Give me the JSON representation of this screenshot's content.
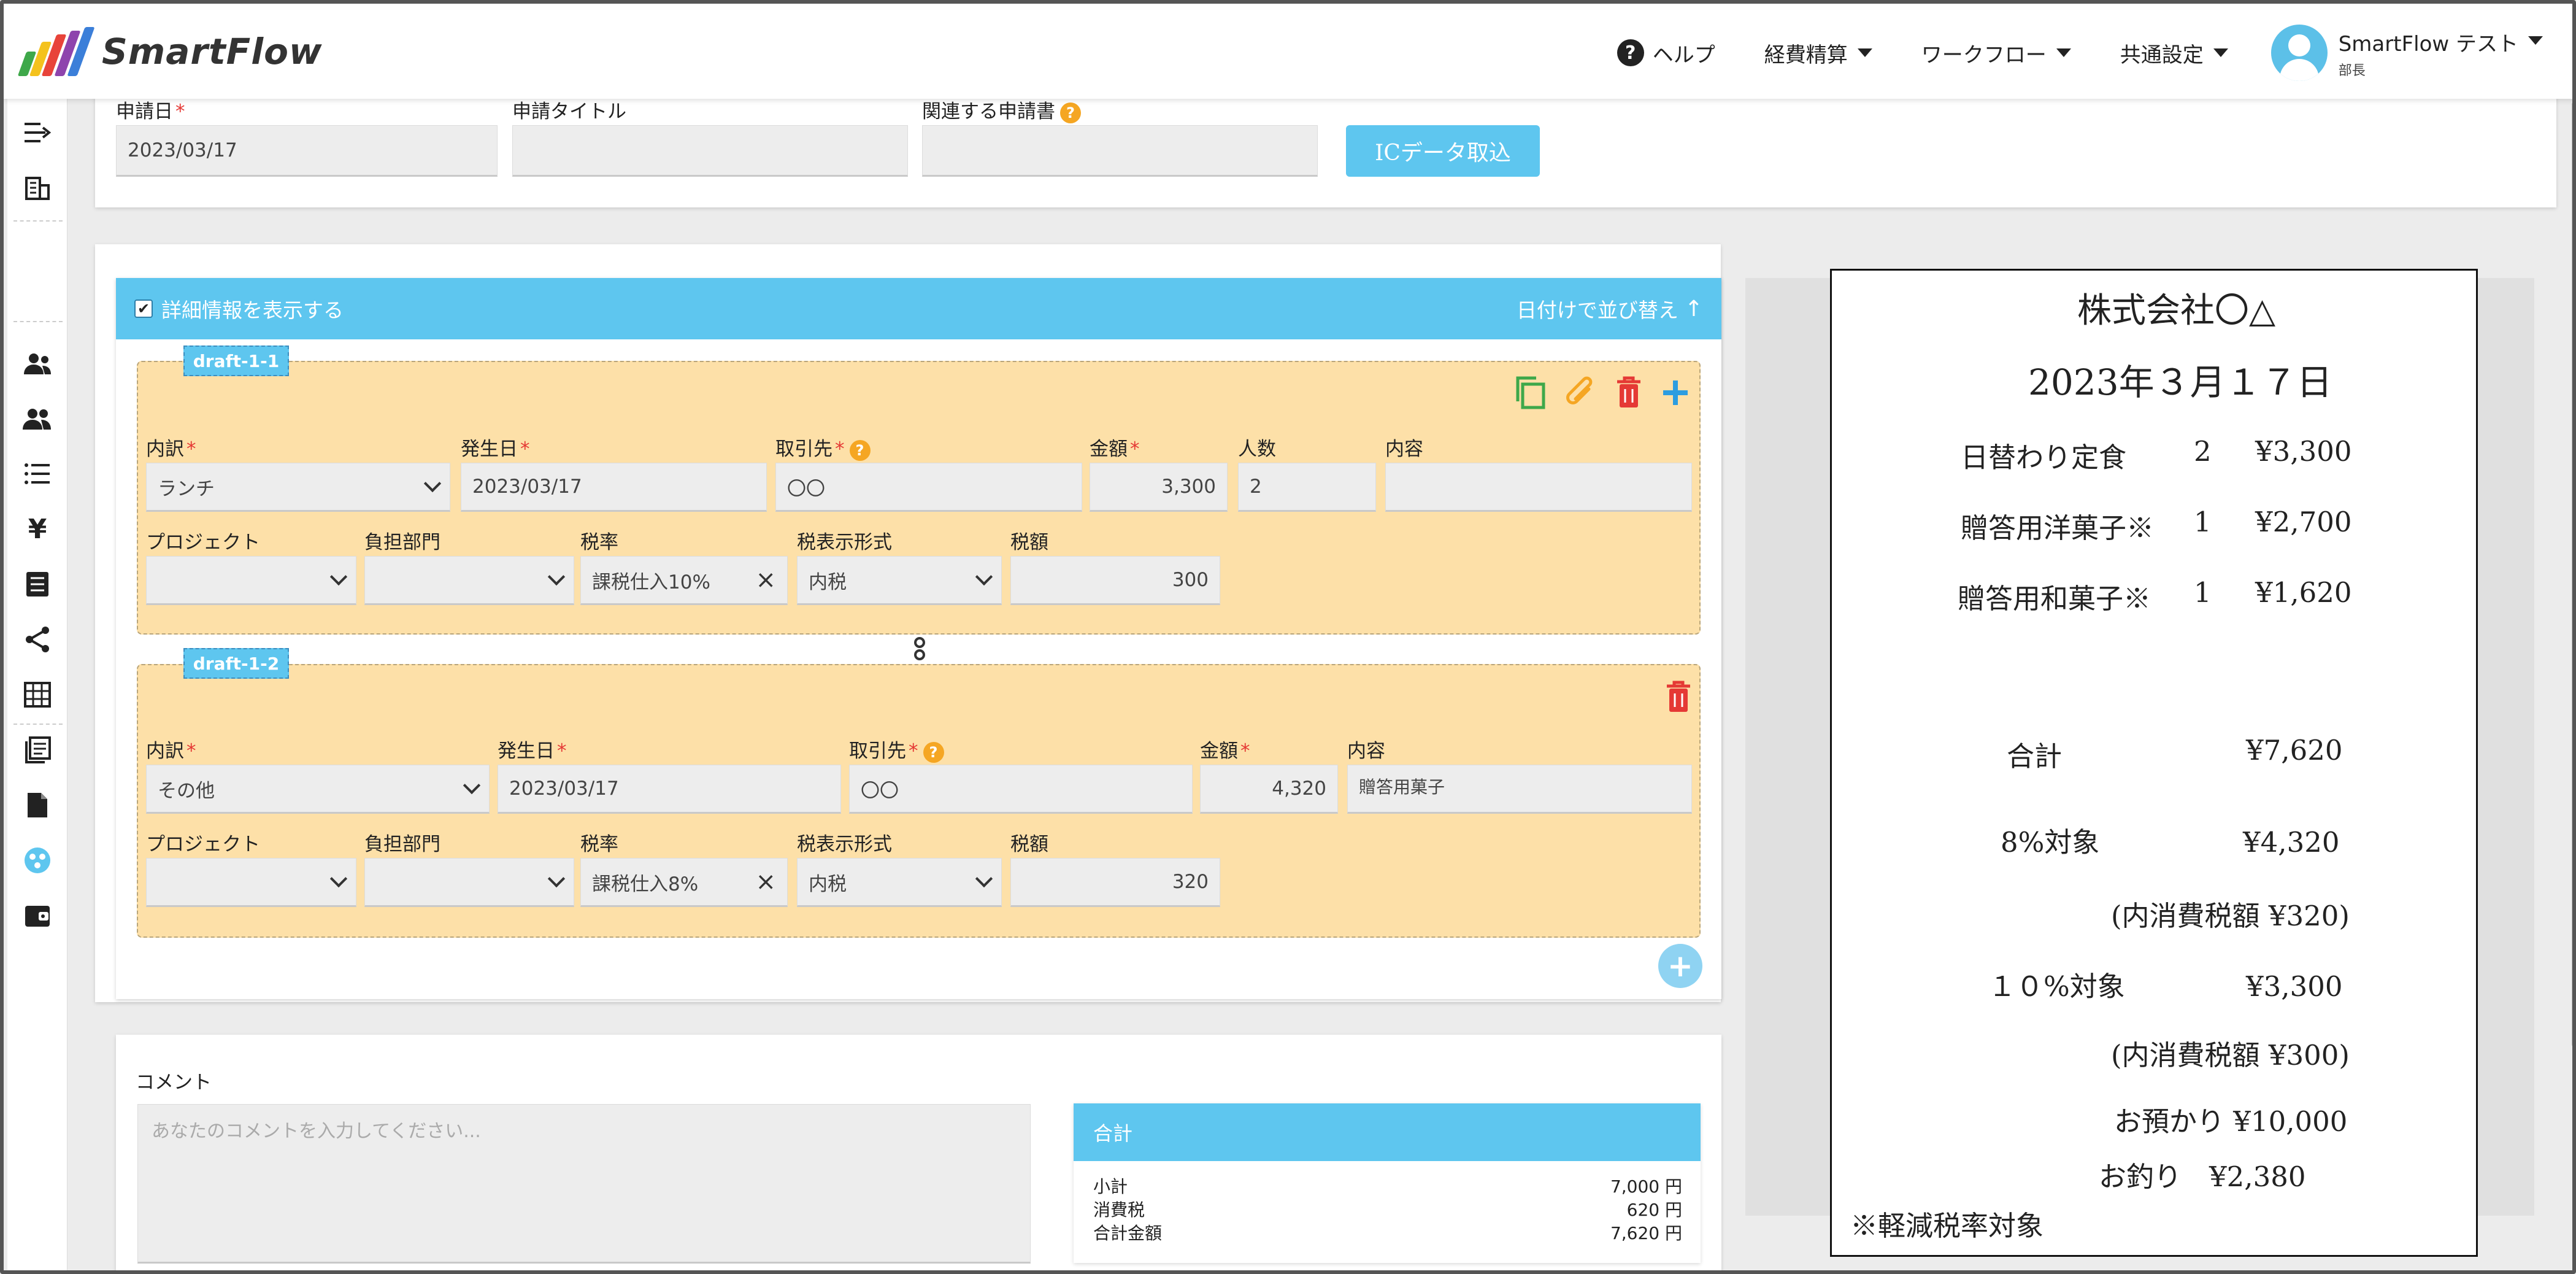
{
  "app": {
    "name": "SmartFlow",
    "logo_colors": [
      "#3ea84a",
      "#f4c21d",
      "#e8443a",
      "#3b7fd9",
      "#8e44ad"
    ]
  },
  "header": {
    "help": "ヘルプ",
    "menu": [
      "経費精算",
      "ワークフロー",
      "共通設定"
    ],
    "user": {
      "name": "SmartFlow テスト",
      "role": "部長"
    }
  },
  "sidebar_icons": [
    "collapse-icon",
    "building-icon",
    "users-icon",
    "group-icon",
    "list-icon",
    "yen-icon",
    "document-icon",
    "share-icon",
    "table-icon",
    "book-icon",
    "file-icon",
    "dashboard-icon",
    "wallet-icon"
  ],
  "form": {
    "date_label": "申請日",
    "date_value": "2023/03/17",
    "title_label": "申請タイトル",
    "title_value": "",
    "related_label": "関連する申請書",
    "ic_button": "ICデータ取込"
  },
  "detail": {
    "show_detail": "詳細情報を表示する",
    "sort": "日付けで並び替え",
    "items": [
      {
        "tag": "draft-1-1",
        "labels": {
          "breakdown": "内訳",
          "date": "発生日",
          "vendor": "取引先",
          "amount": "金額",
          "people": "人数",
          "content": "内容",
          "project": "プロジェクト",
          "dept": "負担部門",
          "tax_rate": "税率",
          "tax_format": "税表示形式",
          "tax": "税額"
        },
        "breakdown": "ランチ",
        "date": "2023/03/17",
        "vendor": "〇〇",
        "amount": "3,300",
        "people": "2",
        "content": "",
        "tax_rate": "課税仕入10%",
        "tax_format": "内税",
        "tax": "300"
      },
      {
        "tag": "draft-1-2",
        "labels": {
          "breakdown": "内訳",
          "date": "発生日",
          "vendor": "取引先",
          "amount": "金額",
          "content": "内容",
          "project": "プロジェクト",
          "dept": "負担部門",
          "tax_rate": "税率",
          "tax_format": "税表示形式",
          "tax": "税額"
        },
        "breakdown": "その他",
        "date": "2023/03/17",
        "vendor": "〇〇",
        "amount": "4,320",
        "content": "贈答用菓子",
        "tax_rate": "課税仕入8%",
        "tax_format": "内税",
        "tax": "320"
      }
    ]
  },
  "comment": {
    "label": "コメント",
    "placeholder": "あなたのコメントを入力してください..."
  },
  "total": {
    "title": "合計",
    "rows": [
      {
        "label": "小計",
        "value": "7,000 円"
      },
      {
        "label": "消費税",
        "value": "620 円"
      },
      {
        "label": "合計金額",
        "value": "7,620 円"
      }
    ]
  },
  "receipt": {
    "company": "株式会社〇△",
    "date": "2023年３月１７日",
    "items": [
      {
        "name": "日替わり定食",
        "qty": "2",
        "price": "¥3,300"
      },
      {
        "name": "贈答用洋菓子※",
        "qty": "1",
        "price": "¥2,700"
      },
      {
        "name": "贈答用和菓子※",
        "qty": "1",
        "price": "¥1,620"
      }
    ],
    "total_label": "合計",
    "total_value": "¥7,620",
    "r8_label": "8%対象",
    "r8_value": "¥4,320",
    "r8_tax": "(内消費税額 ¥320)",
    "r10_label": "１０%対象",
    "r10_value": "¥3,300",
    "r10_tax": "(内消費税額 ¥300)",
    "deposit": "お預かり ¥10,000",
    "change": "お釣り　¥2,380",
    "note": "※軽減税率対象"
  }
}
